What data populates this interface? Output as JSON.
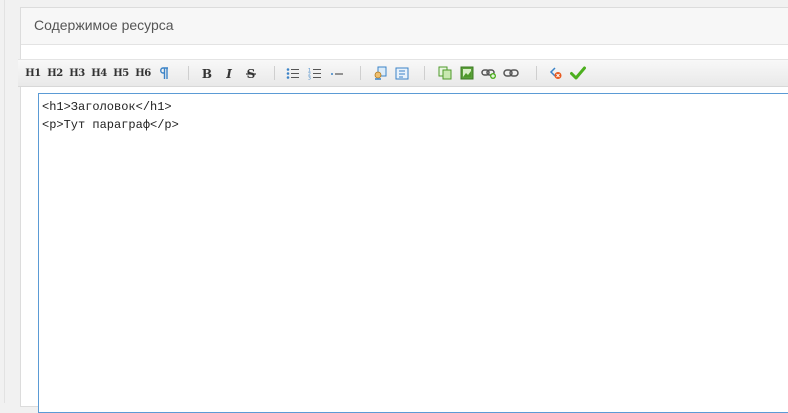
{
  "panel": {
    "title": "Содержимое ресурса"
  },
  "toolbar": {
    "headings": [
      "H1",
      "H2",
      "H3",
      "H4",
      "H5",
      "H6"
    ],
    "groups": [
      [
        "paragraph-icon"
      ],
      [
        "bold-icon",
        "italic-icon",
        "strikethrough-icon"
      ],
      [
        "unordered-list-icon",
        "ordered-list-icon",
        "horizontal-rule-icon"
      ],
      [
        "typograph-icon",
        "preview-icon"
      ],
      [
        "copy-icon",
        "image-icon",
        "add-link-icon",
        "link-icon"
      ],
      [
        "undo-icon",
        "save-check-icon"
      ]
    ]
  },
  "editor": {
    "content": "<h1>Заголовок</h1>\n<p>Тут параграф</p>"
  },
  "colors": {
    "accent_blue": "#5b9bd5",
    "check_green": "#4caf1e",
    "paragraph_blue": "#3b83c7"
  }
}
